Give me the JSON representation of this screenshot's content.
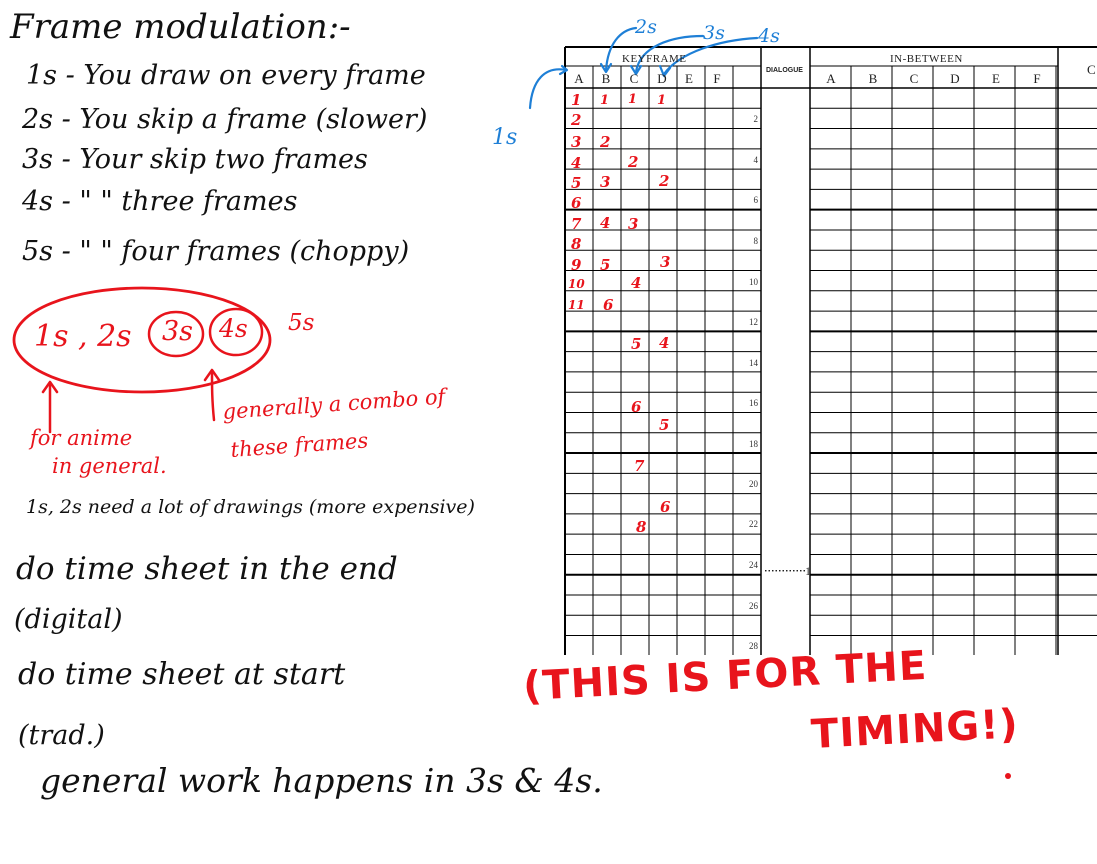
{
  "notes": {
    "title": "Frame modulation:-",
    "lines": [
      "1s - You draw on every frame",
      "2s - You skip a frame (slower)",
      "3s - Your skip two frames",
      "4s -  \"      \"     three frames",
      "5s -  \"     \"   four frames (choppy)"
    ],
    "circled_labels": [
      "1s , 2s",
      "3s",
      "4s"
    ],
    "uncircled_label": "5s",
    "annotation_left": [
      "for anime",
      "in general."
    ],
    "annotation_right": [
      "generally a combo of",
      "these frames"
    ],
    "cost_note": "1s, 2s need a lot of drawings (more expensive)",
    "digital_note": [
      "do time sheet in the end",
      "(digital)"
    ],
    "trad_note": [
      "do time sheet at start",
      "(trad.)"
    ],
    "general_note": "general work happens in 3s & 4s.",
    "timing_note": [
      "(THIS IS FOR THE",
      "TIMING!)"
    ]
  },
  "blue_marks": {
    "labels": [
      "2s",
      "3s",
      "4s",
      "1s"
    ]
  },
  "sheet": {
    "keyframe_header": "KEYFRAME",
    "dialogue_header": "DIALOGUE",
    "inbetween_header": "IN-BETWEEN",
    "cut_header": "C",
    "keyframe_columns": [
      "A",
      "B",
      "C",
      "D",
      "E",
      "F"
    ],
    "inbetween_columns": [
      "A",
      "B",
      "C",
      "D",
      "E",
      "F"
    ],
    "row_numbers": [
      "2",
      "4",
      "6",
      "8",
      "10",
      "12",
      "14",
      "16",
      "18",
      "20",
      "22",
      "24",
      "26",
      "28"
    ],
    "marker_24": "1",
    "col_A_frames": [
      "1",
      "2",
      "3",
      "4",
      "5",
      "6",
      "7",
      "8",
      "9",
      "10",
      "11"
    ],
    "col_B_frames": [
      "1",
      "2",
      "3",
      "4",
      "5",
      "6"
    ],
    "col_C_frames": [
      "1",
      "2",
      "3",
      "4",
      "5",
      "6",
      "7",
      "8"
    ],
    "col_D_frames": [
      "1",
      "2",
      "3",
      "4",
      "5",
      "6"
    ]
  },
  "colors": {
    "ink": "#111111",
    "red": "#e8141c",
    "blue": "#1e7fd6",
    "grid": "#000000"
  }
}
